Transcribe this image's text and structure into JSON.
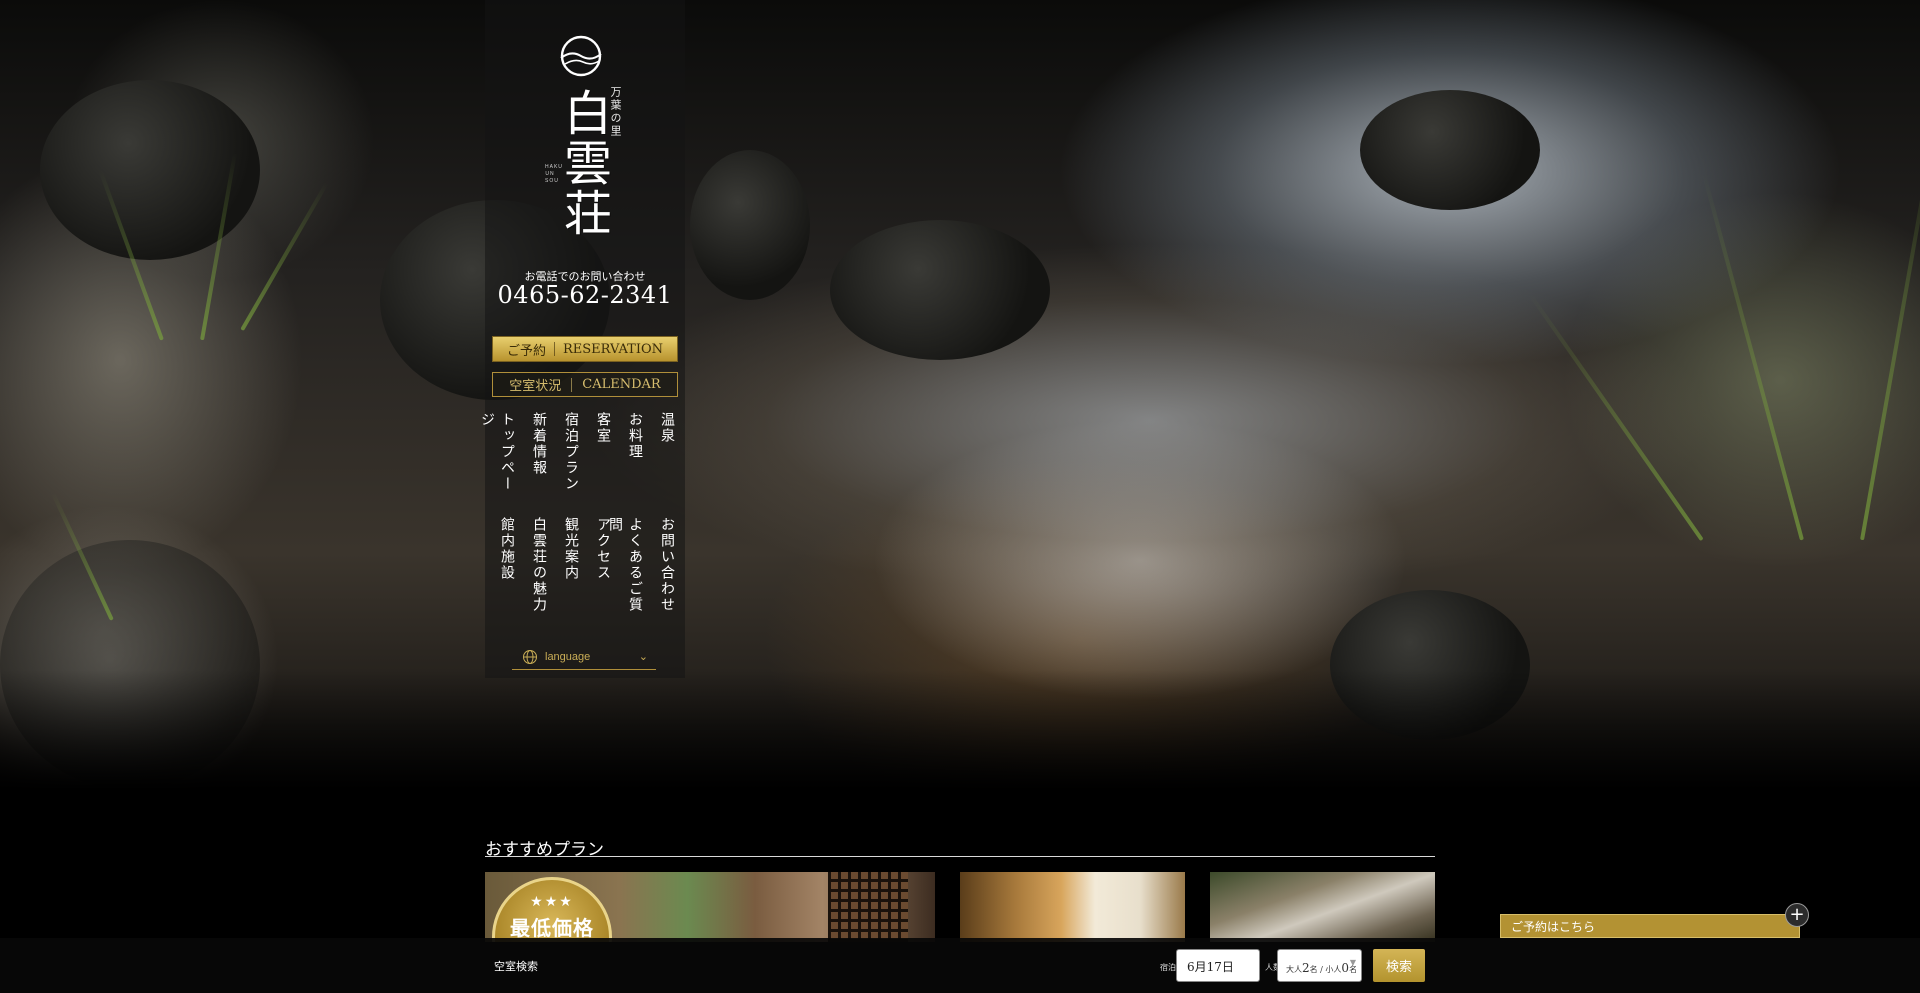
{
  "hero": {
    "scene": "river-rapids-background"
  },
  "logo": {
    "main_text": "白雲荘",
    "sub_text": "万葉の里",
    "roman_text": "HAKU UN SOU",
    "icon": "moon-wave-logo-icon"
  },
  "contact": {
    "caption": "お電話でのお問い合わせ",
    "phone": "0465-62-2341"
  },
  "buttons": {
    "reservation_ja": "ご予約",
    "reservation_en": "RESERVATION",
    "calendar_ja": "空室状況",
    "calendar_en": "CALENDAR"
  },
  "nav": {
    "row1": [
      "温泉",
      "お料理",
      "客室",
      "宿泊プラン",
      "新着情報",
      "トップページ"
    ],
    "row2": [
      "お問い合わせ",
      "よくあるご質問",
      "アクセス",
      "観光案内",
      "白雲荘の魅力",
      "館内施設"
    ]
  },
  "language": {
    "label": "language",
    "icon": "globe-icon"
  },
  "plans": {
    "title": "おすすめプラン",
    "badge_stars": "★★★",
    "badge_text": "最低価格"
  },
  "accordion": {
    "label": "ご予約はこちら"
  },
  "booking": {
    "title": "空室検索",
    "checkin_label": "宿泊日",
    "checkin_value": "6月17日",
    "guests_label": "人数",
    "guests_prefix": "大人",
    "guests_adults": "2",
    "guests_mid": "名 / 小人",
    "guests_children": "0",
    "guests_suffix": "名",
    "search_label": "検索"
  },
  "colors": {
    "gold": "#b39233",
    "gold_light": "#e8cf6e",
    "background": "#000000"
  }
}
